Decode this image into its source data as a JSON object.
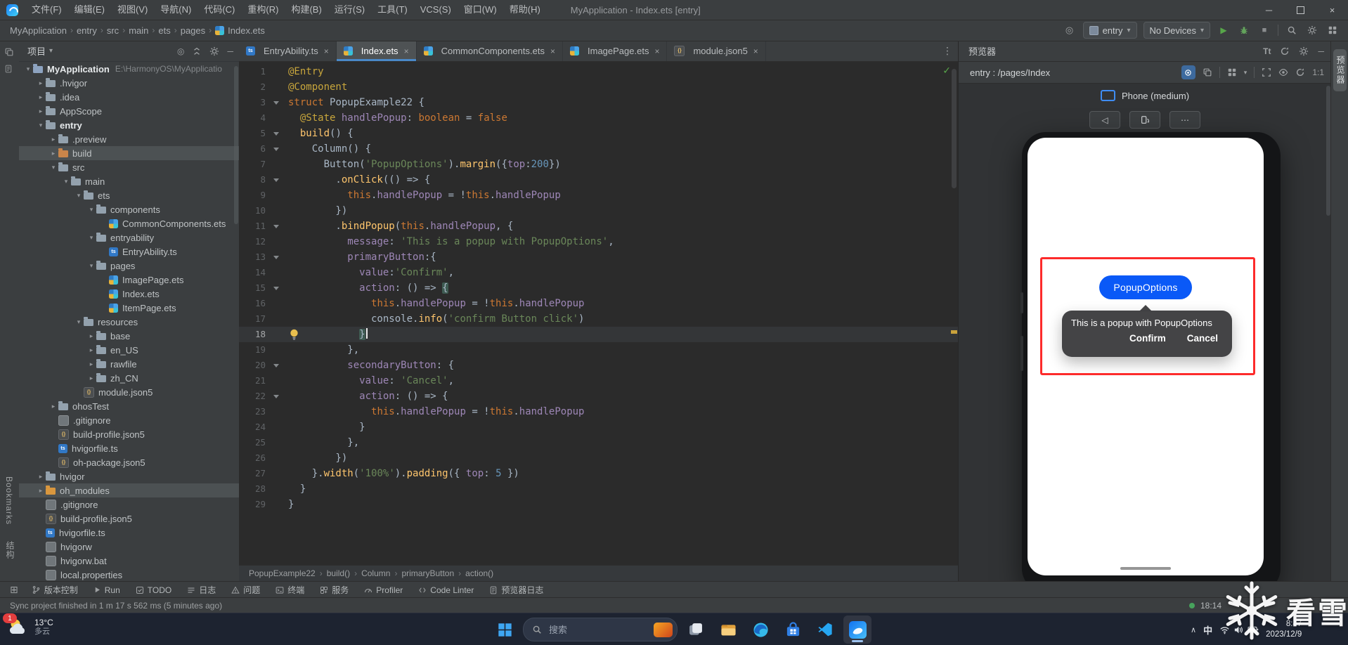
{
  "colors": {
    "accent_blue": "#0a59f7",
    "highlight_red": "#fd2b2b",
    "run_green": "#57a64a",
    "active_tab_underline": "#4a88c7",
    "editor_background": "#2b2b2b",
    "panel_background": "#3b3e40"
  },
  "icons": {
    "caret-down": "▾",
    "caret-right": "▸",
    "more-vertical": "⋮",
    "more-horizontal": "⋯",
    "breadcrumb-separator": "›",
    "minimize": "─",
    "close": "×",
    "run-play": "▶",
    "stop": "■",
    "inspect-ok-check": "✓",
    "rotate-left": "◁",
    "tray-chevron-up": "∧",
    "locate": "◎",
    "tool-windows-grid": "⊞",
    "font-size": "Tt"
  },
  "titlebar": {
    "menus": [
      "文件(F)",
      "编辑(E)",
      "视图(V)",
      "导航(N)",
      "代码(C)",
      "重构(R)",
      "构建(B)",
      "运行(S)",
      "工具(T)",
      "VCS(S)",
      "窗口(W)",
      "帮助(H)"
    ],
    "title": "MyApplication - Index.ets [entry]"
  },
  "toolbar": {
    "breadcrumbs": [
      "MyApplication",
      "entry",
      "src",
      "main",
      "ets",
      "pages",
      "Index.ets"
    ],
    "module_selector": "entry",
    "device_selector": "No Devices"
  },
  "project_panel": {
    "header": "项目",
    "tree": [
      {
        "i": 0,
        "c": 1,
        "ic": "folder-proj",
        "t": "MyApplication",
        "b": 1,
        "sub": "E:\\HarmonyOS\\MyApplicatio"
      },
      {
        "i": 1,
        "c": 2,
        "ic": "folder",
        "t": ".hvigor"
      },
      {
        "i": 1,
        "c": 2,
        "ic": "folder",
        "t": ".idea"
      },
      {
        "i": 1,
        "c": 2,
        "ic": "folder",
        "t": "AppScope"
      },
      {
        "i": 1,
        "c": 1,
        "ic": "folder-mod",
        "t": "entry",
        "b": 1
      },
      {
        "i": 2,
        "c": 2,
        "ic": "folder",
        "t": ".preview"
      },
      {
        "i": 2,
        "c": 2,
        "ic": "folder-build",
        "t": "build",
        "sel": 1
      },
      {
        "i": 2,
        "c": 1,
        "ic": "folder",
        "t": "src"
      },
      {
        "i": 3,
        "c": 1,
        "ic": "folder",
        "t": "main"
      },
      {
        "i": 4,
        "c": 1,
        "ic": "folder",
        "t": "ets"
      },
      {
        "i": 5,
        "c": 1,
        "ic": "folder",
        "t": "components"
      },
      {
        "i": 6,
        "c": 0,
        "ic": "ets",
        "t": "CommonComponents.ets"
      },
      {
        "i": 5,
        "c": 1,
        "ic": "folder",
        "t": "entryability"
      },
      {
        "i": 6,
        "c": 0,
        "ic": "ts",
        "t": "EntryAbility.ts"
      },
      {
        "i": 5,
        "c": 1,
        "ic": "folder",
        "t": "pages"
      },
      {
        "i": 6,
        "c": 0,
        "ic": "ets",
        "t": "ImagePage.ets"
      },
      {
        "i": 6,
        "c": 0,
        "ic": "ets",
        "t": "Index.ets"
      },
      {
        "i": 6,
        "c": 0,
        "ic": "ets",
        "t": "ItemPage.ets"
      },
      {
        "i": 4,
        "c": 1,
        "ic": "folder",
        "t": "resources"
      },
      {
        "i": 5,
        "c": 2,
        "ic": "folder",
        "t": "base"
      },
      {
        "i": 5,
        "c": 2,
        "ic": "folder",
        "t": "en_US"
      },
      {
        "i": 5,
        "c": 2,
        "ic": "folder",
        "t": "rawfile"
      },
      {
        "i": 5,
        "c": 2,
        "ic": "folder",
        "t": "zh_CN"
      },
      {
        "i": 4,
        "c": 0,
        "ic": "json",
        "t": "module.json5"
      },
      {
        "i": 2,
        "c": 2,
        "ic": "folder",
        "t": "ohosTest"
      },
      {
        "i": 2,
        "c": 0,
        "ic": "file",
        "t": ".gitignore"
      },
      {
        "i": 2,
        "c": 0,
        "ic": "json",
        "t": "build-profile.json5"
      },
      {
        "i": 2,
        "c": 0,
        "ic": "ts",
        "t": "hvigorfile.ts"
      },
      {
        "i": 2,
        "c": 0,
        "ic": "json",
        "t": "oh-package.json5"
      },
      {
        "i": 1,
        "c": 2,
        "ic": "folder",
        "t": "hvigor"
      },
      {
        "i": 1,
        "c": 2,
        "ic": "folder-lib",
        "t": "oh_modules",
        "sel": 1
      },
      {
        "i": 1,
        "c": 0,
        "ic": "file",
        "t": ".gitignore"
      },
      {
        "i": 1,
        "c": 0,
        "ic": "json",
        "t": "build-profile.json5"
      },
      {
        "i": 1,
        "c": 0,
        "ic": "ts",
        "t": "hvigorfile.ts"
      },
      {
        "i": 1,
        "c": 0,
        "ic": "file",
        "t": "hvigorw"
      },
      {
        "i": 1,
        "c": 0,
        "ic": "file",
        "t": "hvigorw.bat"
      },
      {
        "i": 1,
        "c": 0,
        "ic": "file",
        "t": "local.properties"
      }
    ]
  },
  "editor": {
    "tabs": [
      {
        "label": "EntryAbility.ts",
        "icon": "ts",
        "active": false
      },
      {
        "label": "Index.ets",
        "icon": "ets",
        "active": true
      },
      {
        "label": "CommonComponents.ets",
        "icon": "ets",
        "active": false
      },
      {
        "label": "ImagePage.ets",
        "icon": "ets",
        "active": false
      },
      {
        "label": "module.json5",
        "icon": "json",
        "active": false
      }
    ],
    "active_line": 18,
    "fold_lines": [
      3,
      5,
      6,
      8,
      11,
      13,
      15,
      20,
      22
    ],
    "lines": [
      [
        [
          "a",
          "@Entry"
        ]
      ],
      [
        [
          "a",
          "@Component"
        ]
      ],
      [
        [
          "k",
          "struct "
        ],
        [
          "d",
          "PopupExample22 {"
        ]
      ],
      [
        [
          "d",
          "  "
        ],
        [
          "a",
          "@State"
        ],
        [
          "d",
          " "
        ],
        [
          "p",
          "handlePopup"
        ],
        [
          "d",
          ": "
        ],
        [
          "k",
          "boolean"
        ],
        [
          "d",
          " = "
        ],
        [
          "k",
          "false"
        ]
      ],
      [
        [
          "d",
          "  "
        ],
        [
          "m",
          "build"
        ],
        [
          "d",
          "() {"
        ]
      ],
      [
        [
          "d",
          "    Column() {"
        ]
      ],
      [
        [
          "d",
          "      Button("
        ],
        [
          "s",
          "'PopupOptions'"
        ],
        [
          "d",
          ")."
        ],
        [
          "m",
          "margin"
        ],
        [
          "d",
          "({"
        ],
        [
          "p",
          "top"
        ],
        [
          "d",
          ":"
        ],
        [
          "n",
          "200"
        ],
        [
          "d",
          "})"
        ]
      ],
      [
        [
          "d",
          "        ."
        ],
        [
          "m",
          "onClick"
        ],
        [
          "d",
          "(() => {"
        ]
      ],
      [
        [
          "d",
          "          "
        ],
        [
          "k",
          "this"
        ],
        [
          "d",
          "."
        ],
        [
          "p",
          "handlePopup"
        ],
        [
          "d",
          " = !"
        ],
        [
          "k",
          "this"
        ],
        [
          "d",
          "."
        ],
        [
          "p",
          "handlePopup"
        ]
      ],
      [
        [
          "d",
          "        })"
        ]
      ],
      [
        [
          "d",
          "        ."
        ],
        [
          "m",
          "bindPopup"
        ],
        [
          "d",
          "("
        ],
        [
          "k",
          "this"
        ],
        [
          "d",
          "."
        ],
        [
          "p",
          "handlePopup"
        ],
        [
          "d",
          ", {"
        ]
      ],
      [
        [
          "d",
          "          "
        ],
        [
          "p",
          "message"
        ],
        [
          "d",
          ": "
        ],
        [
          "s",
          "'This is a popup with PopupOptions'"
        ],
        [
          "d",
          ","
        ]
      ],
      [
        [
          "d",
          "          "
        ],
        [
          "p",
          "primaryButton"
        ],
        [
          "d",
          ":{"
        ]
      ],
      [
        [
          "d",
          "            "
        ],
        [
          "p",
          "value"
        ],
        [
          "d",
          ":"
        ],
        [
          "s",
          "'Confirm'"
        ],
        [
          "d",
          ","
        ]
      ],
      [
        [
          "d",
          "            "
        ],
        [
          "p",
          "action"
        ],
        [
          "d",
          ": () => "
        ],
        [
          "hb",
          "{"
        ]
      ],
      [
        [
          "d",
          "              "
        ],
        [
          "k",
          "this"
        ],
        [
          "d",
          "."
        ],
        [
          "p",
          "handlePopup"
        ],
        [
          "d",
          " = !"
        ],
        [
          "k",
          "this"
        ],
        [
          "d",
          "."
        ],
        [
          "p",
          "handlePopup"
        ]
      ],
      [
        [
          "d",
          "              console."
        ],
        [
          "m",
          "info"
        ],
        [
          "d",
          "("
        ],
        [
          "s",
          "'confirm Button click'"
        ],
        [
          "d",
          ")"
        ]
      ],
      [
        [
          "d",
          "            "
        ],
        [
          "hb",
          "}"
        ]
      ],
      [
        [
          "d",
          "          },"
        ]
      ],
      [
        [
          "d",
          "          "
        ],
        [
          "p",
          "secondaryButton"
        ],
        [
          "d",
          ": {"
        ]
      ],
      [
        [
          "d",
          "            "
        ],
        [
          "p",
          "value"
        ],
        [
          "d",
          ": "
        ],
        [
          "s",
          "'Cancel'"
        ],
        [
          "d",
          ","
        ]
      ],
      [
        [
          "d",
          "            "
        ],
        [
          "p",
          "action"
        ],
        [
          "d",
          ": () => {"
        ]
      ],
      [
        [
          "d",
          "              "
        ],
        [
          "k",
          "this"
        ],
        [
          "d",
          "."
        ],
        [
          "p",
          "handlePopup"
        ],
        [
          "d",
          " = !"
        ],
        [
          "k",
          "this"
        ],
        [
          "d",
          "."
        ],
        [
          "p",
          "handlePopup"
        ]
      ],
      [
        [
          "d",
          "            }"
        ]
      ],
      [
        [
          "d",
          "          },"
        ]
      ],
      [
        [
          "d",
          "        })"
        ]
      ],
      [
        [
          "d",
          "    }."
        ],
        [
          "m",
          "width"
        ],
        [
          "d",
          "("
        ],
        [
          "s",
          "'100%'"
        ],
        [
          "d",
          ")."
        ],
        [
          "m",
          "padding"
        ],
        [
          "d",
          "({ "
        ],
        [
          "p",
          "top"
        ],
        [
          "d",
          ": "
        ],
        [
          "n",
          "5"
        ],
        [
          "d",
          " })"
        ]
      ],
      [
        [
          "d",
          "  }"
        ]
      ],
      [
        [
          "d",
          "}"
        ]
      ]
    ],
    "breadcrumbs": [
      "PopupExample22",
      "build()",
      "Column",
      "primaryButton",
      "action()"
    ]
  },
  "previewer": {
    "title": "预览器",
    "route": "entry : /pages/Index",
    "device": "Phone (medium)",
    "zoom_ratio": "1:1",
    "screen": {
      "button_label": "PopupOptions",
      "popup_message": "This is a popup with PopupOptions",
      "confirm_label": "Confirm",
      "cancel_label": "Cancel"
    }
  },
  "stripes": {
    "right_label": "预览器",
    "left_bottom_labels": [
      "Bookmarks",
      "结构"
    ]
  },
  "bottom_bar": {
    "items": [
      {
        "label": "版本控制",
        "icon": "branch"
      },
      {
        "label": "Run",
        "icon": "play-sm"
      },
      {
        "label": "TODO",
        "icon": "todo"
      },
      {
        "label": "日志",
        "icon": "log"
      },
      {
        "label": "问题",
        "icon": "warn"
      },
      {
        "label": "终端",
        "icon": "terminal"
      },
      {
        "label": "服务",
        "icon": "services"
      },
      {
        "label": "Profiler",
        "icon": "profiler"
      },
      {
        "label": "Code Linter",
        "icon": "lint"
      },
      {
        "label": "预览器日志",
        "icon": "doc"
      }
    ]
  },
  "status_bar": {
    "message": "Sync project finished in 1 m 17 s 562 ms (5 minutes ago)",
    "caret_position": "18:14"
  },
  "taskbar": {
    "weather": {
      "temp": "13°C",
      "condition": "多云",
      "badge": "1"
    },
    "search_placeholder": "搜索",
    "apps": [
      "task-view",
      "file-explorer",
      "edge",
      "store",
      "vscode",
      "deveco"
    ],
    "active_app": "deveco",
    "ime": "中",
    "clock": {
      "time": "8:47",
      "date": "2023/12/9"
    }
  },
  "watermark": {
    "text": "看雪"
  }
}
